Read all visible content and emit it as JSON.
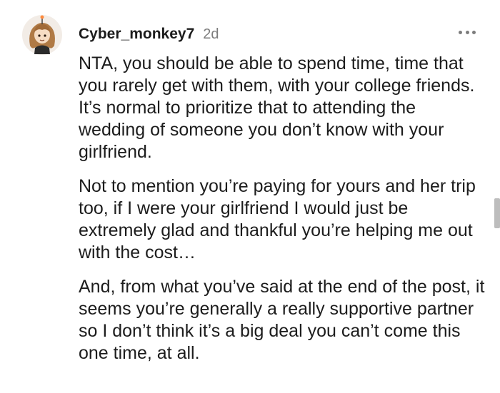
{
  "comment": {
    "author": "Cyber_monkey7",
    "age": "2d",
    "paragraphs": [
      "NTA, you should be able to spend time, time that you rarely get with them, with your college friends. It’s normal to prioritize that to attending the wedding of someone you don’t know with your girlfriend.",
      "Not to mention you’re paying for yours and her trip too, if I were your girlfriend I would just be extremely glad and thankful you’re helping me out with the cost…",
      "And, from what you’ve said at the end of the post, it seems you’re generally a really supportive partner so I don’t think it’s a big deal you can’t come this one time, at all."
    ]
  },
  "icons": {
    "avatar": "avatar-icon",
    "more": "more-options-icon"
  },
  "colors": {
    "text": "#1c1c1c",
    "muted": "#7c7c7c",
    "background": "#ffffff"
  }
}
